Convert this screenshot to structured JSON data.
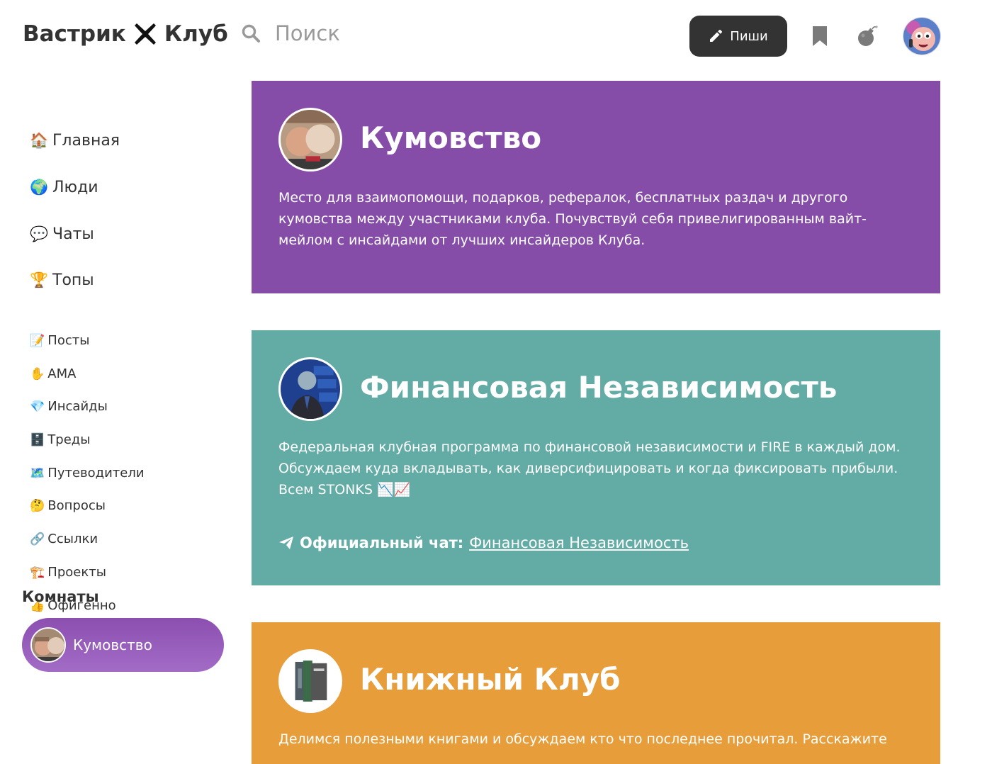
{
  "header": {
    "logo_left": "Вастрик",
    "logo_right": "Клуб",
    "search_placeholder": "Поиск",
    "write_label": "Пиши"
  },
  "sidebar": {
    "main_nav": [
      {
        "emoji": "🏠",
        "label": "Главная"
      },
      {
        "emoji": "🌍",
        "label": "Люди"
      },
      {
        "emoji": "💬",
        "label": "Чаты"
      },
      {
        "emoji": "🏆",
        "label": "Топы"
      }
    ],
    "sub_nav": [
      {
        "emoji": "📝",
        "label": "Посты"
      },
      {
        "emoji": "✋",
        "label": "AMA"
      },
      {
        "emoji": "💎",
        "label": "Инсайды"
      },
      {
        "emoji": "🗄️",
        "label": "Треды"
      },
      {
        "emoji": "🗺️",
        "label": "Путеводители"
      },
      {
        "emoji": "🤔",
        "label": "Вопросы"
      },
      {
        "emoji": "🔗",
        "label": "Ссылки"
      },
      {
        "emoji": "🏗️",
        "label": "Проекты"
      },
      {
        "emoji": "👍",
        "label": "Офигенно"
      }
    ],
    "rooms_title": "Комнаты",
    "active_room": "Кумовство"
  },
  "rooms": [
    {
      "title": "Кумовство",
      "description": "Место для взаимопомощи, подарков, рефералок, бесплатных раздач и другого кумовства между участниками клуба. Почувствуй себя привелигированным вайт-мейлом с инсайдами от лучших инсайдеров Клуба.",
      "color": "#854da7"
    },
    {
      "title": "Финансовая Независимость",
      "description": "Федеральная клубная программа по финансовой независимости и FIRE в каждый дом. Обсуждаем куда вкладывать, как диверсифицировать и когда фиксировать прибыли. Всем STONKS 📉📈",
      "chat_label": "Официальный чат:",
      "chat_link": "Финансовая Независимость",
      "color": "#63aba5"
    },
    {
      "title": "Книжный Клуб",
      "description": "Делимся полезными книгами и обсуждаем кто что последнее прочитал. Расскажите",
      "color": "#e69d3a"
    }
  ]
}
